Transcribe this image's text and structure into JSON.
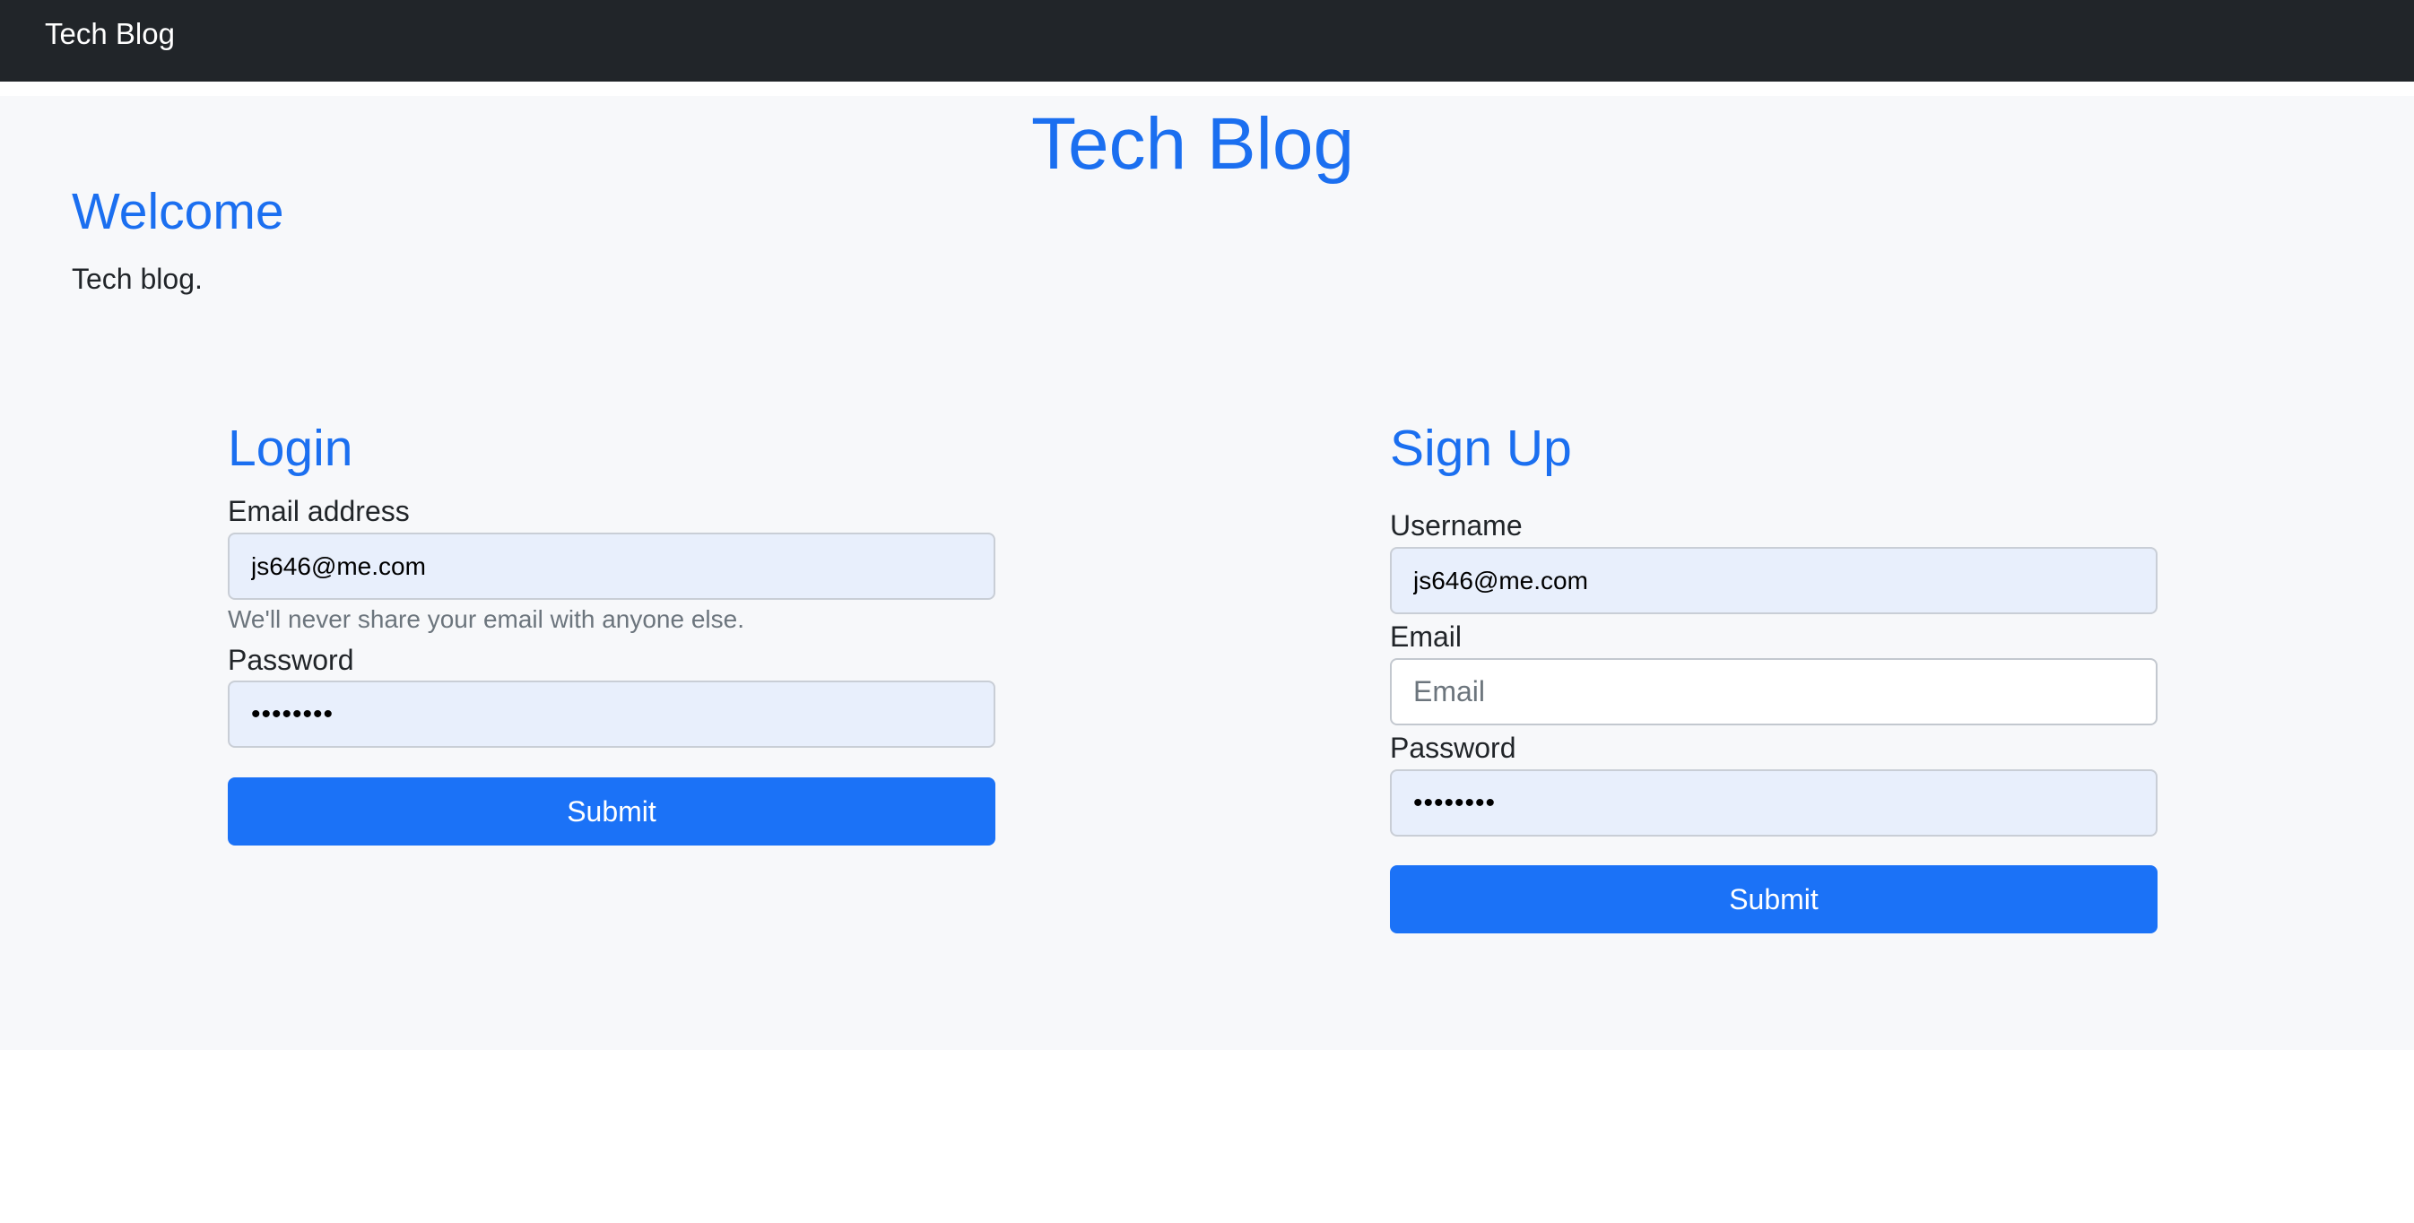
{
  "navbar": {
    "brand": "Tech Blog"
  },
  "header": {
    "title": "Tech Blog",
    "welcome_heading": "Welcome",
    "welcome_text": "Tech blog."
  },
  "login": {
    "title": "Login",
    "email_label": "Email address",
    "email_value": "js646@me.com",
    "email_help": "We'll never share your email with anyone else.",
    "password_label": "Password",
    "password_value": "12345678",
    "submit_label": "Submit"
  },
  "signup": {
    "title": "Sign Up",
    "username_label": "Username",
    "username_value": "js646@me.com",
    "email_label": "Email",
    "email_value": "",
    "email_placeholder": "Email",
    "password_label": "Password",
    "password_value": "12345678",
    "submit_label": "Submit"
  },
  "colors": {
    "navbar_bg": "#212529",
    "accent": "#1b6ff0",
    "button_bg": "#1b72f7",
    "autofill_bg": "#e8effc",
    "content_bg": "#f7f8fa"
  }
}
